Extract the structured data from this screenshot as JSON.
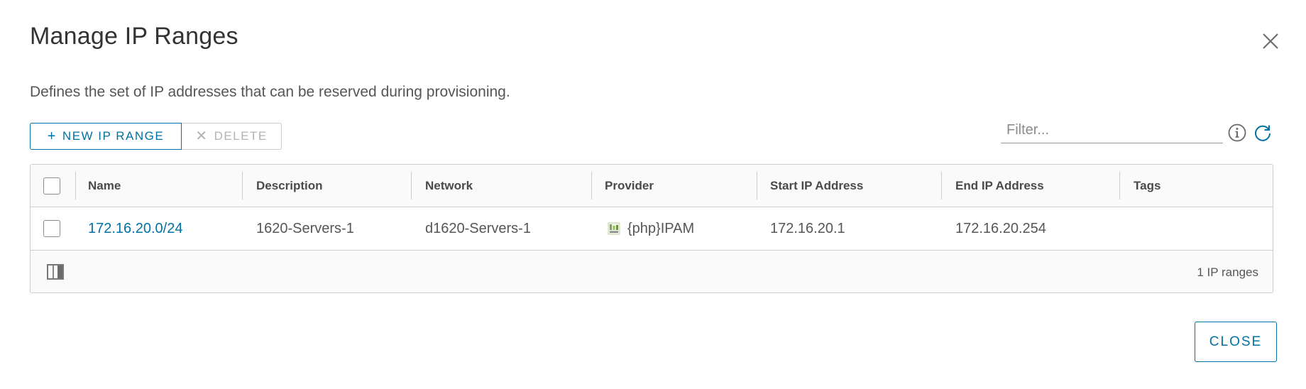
{
  "dialog": {
    "title": "Manage IP Ranges",
    "description": "Defines the set of IP addresses that can be reserved during provisioning."
  },
  "toolbar": {
    "new_label": "NEW IP RANGE",
    "new_icon": "plus-icon",
    "delete_label": "DELETE",
    "delete_icon": "x-icon",
    "filter_placeholder": "Filter..."
  },
  "grid": {
    "columns": [
      "Name",
      "Description",
      "Network",
      "Provider",
      "Start IP Address",
      "End IP Address",
      "Tags"
    ],
    "rows": [
      {
        "name": "172.16.20.0/24",
        "description": "1620-Servers-1",
        "network": "d1620-Servers-1",
        "provider": "{php}IPAM",
        "start_ip": "172.16.20.1",
        "end_ip": "172.16.20.254",
        "tags": ""
      }
    ],
    "footer_count": "1 IP ranges"
  },
  "actions": {
    "close_label": "CLOSE"
  },
  "colors": {
    "accent": "#0072a3",
    "text": "#565656",
    "border": "#cccccc"
  }
}
